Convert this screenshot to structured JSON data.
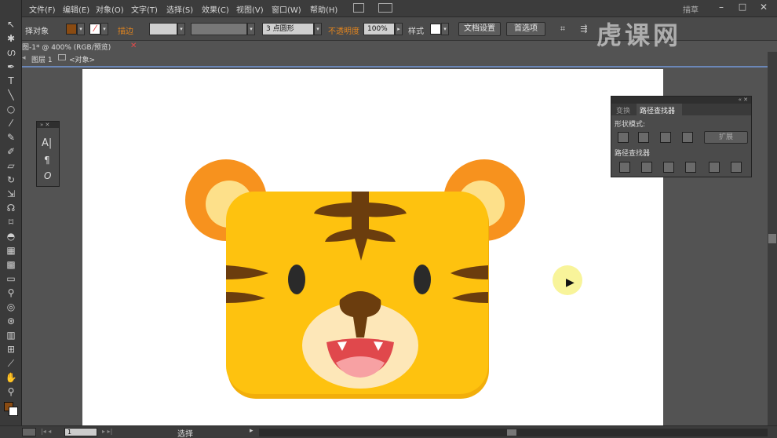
{
  "menubar": {
    "items": [
      "文件(F)",
      "编辑(E)",
      "对象(O)",
      "文字(T)",
      "选择(S)",
      "效果(C)",
      "视图(V)",
      "窗口(W)",
      "帮助(H)"
    ],
    "workspace": "描草"
  },
  "control_bar": {
    "selection_label": "择对象",
    "stroke_label": "描边",
    "brush_value": "3 点圆形",
    "opacity_label": "不透明度",
    "opacity_value": "100%",
    "style_label": "样式",
    "doc_setup": "文档设置",
    "preferences": "首选项",
    "fill_color": "#8a4b12",
    "accent_color": "#e3851e"
  },
  "document_tab": {
    "title": "图-1* @ 400% (RGB/预览)",
    "layer": "图层 1",
    "object": "<对象>"
  },
  "watermark": {
    "text": "虎课网"
  },
  "char_panel": {
    "icons": [
      "type-icon",
      "paragraph-icon",
      "opentype-icon"
    ],
    "glyphs": [
      "A|",
      "¶",
      "O"
    ]
  },
  "pathfinder_panel": {
    "tab_transform": "变换",
    "tab_pathfinder": "路径查找器",
    "shape_modes_label": "形状模式:",
    "expand_label": "扩展",
    "pathfinders_label": "路径查找器"
  },
  "status_bar": {
    "page": "1",
    "mode": "选择"
  },
  "artwork": {
    "body_color": "#fec20f",
    "ear_outer_color": "#f7921e",
    "ear_inner_color": "#fde08a",
    "stripe_color": "#6b3d0e",
    "muzzle_color": "#fde7b8",
    "mouth_color": "#e0484c",
    "tongue_color": "#f7a1a3",
    "eye_color": "#2a2a2a"
  }
}
